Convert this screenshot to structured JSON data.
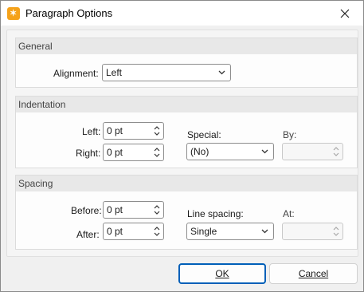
{
  "window": {
    "title": "Paragraph Options",
    "icon": "app-logo-icon",
    "close_icon": "close-icon"
  },
  "general": {
    "header": "General",
    "alignment_label": "Alignment:",
    "alignment_value": "Left"
  },
  "indentation": {
    "header": "Indentation",
    "left_label": "Left:",
    "left_value": "0 pt",
    "right_label": "Right:",
    "right_value": "0 pt",
    "special_label": "Special:",
    "special_value": "(No)",
    "by_label": "By:",
    "by_value": ""
  },
  "spacing": {
    "header": "Spacing",
    "before_label": "Before:",
    "before_value": "0 pt",
    "after_label": "After:",
    "after_value": "0 pt",
    "line_spacing_label": "Line spacing:",
    "line_spacing_value": "Single",
    "at_label": "At:",
    "at_value": ""
  },
  "buttons": {
    "ok": "OK",
    "cancel": "Cancel"
  },
  "colors": {
    "accent": "#005fb8",
    "app_icon": "#f5a21a"
  }
}
